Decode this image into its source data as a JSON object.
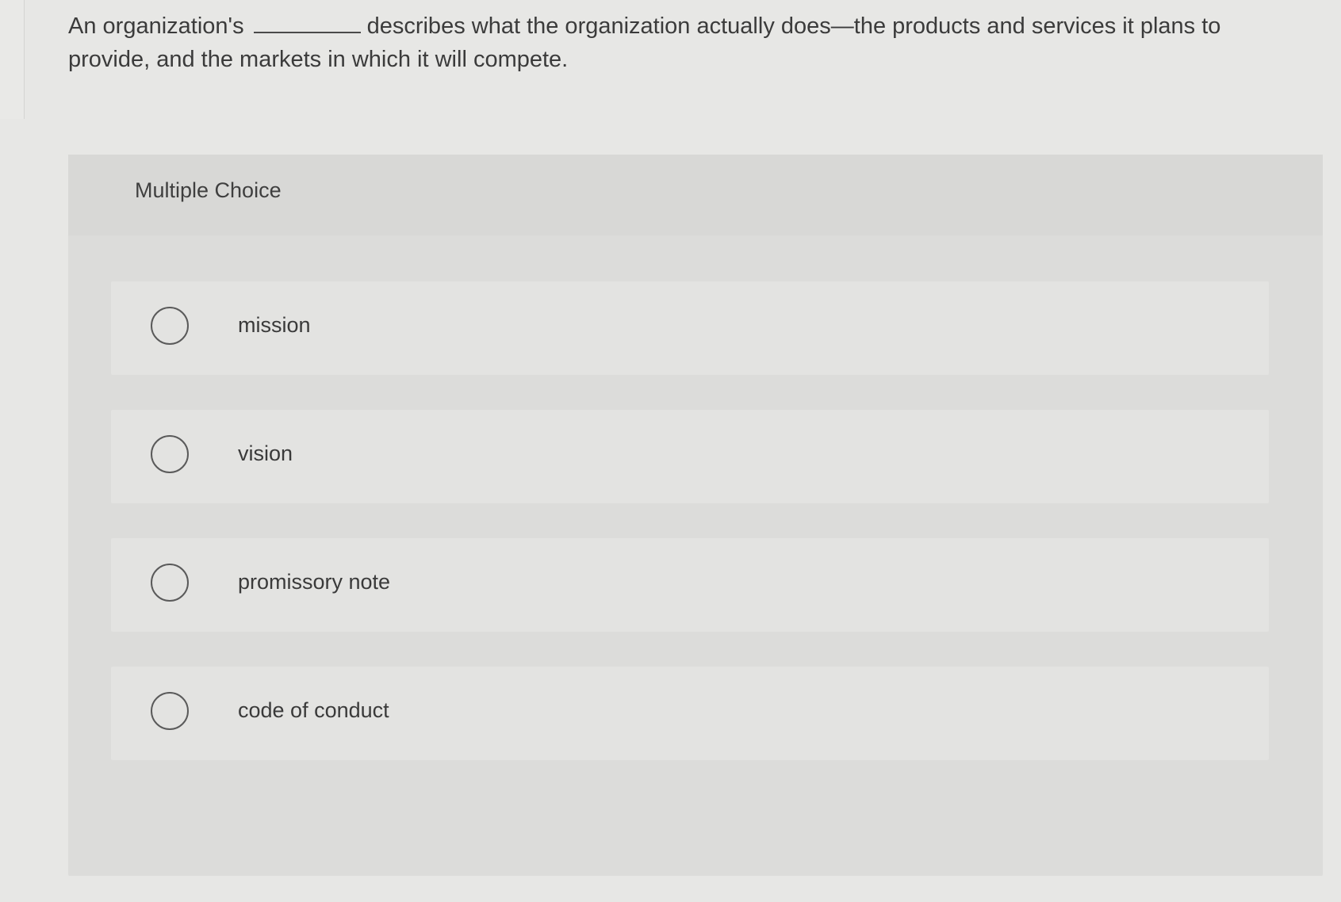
{
  "question": {
    "text_before": "An organization's",
    "text_after": "describes what the organization actually does—the products and services it plans to provide, and the markets in which it will compete."
  },
  "panel": {
    "title": "Multiple Choice",
    "options": [
      {
        "label": "mission"
      },
      {
        "label": "vision"
      },
      {
        "label": "promissory note"
      },
      {
        "label": "code of conduct"
      }
    ]
  },
  "colors": {
    "page_background": "#e7e7e5",
    "panel_background": "#dcdcda",
    "option_background": "#e3e3e1",
    "text": "#3a3a3a"
  },
  "icons": {
    "option_marker": "radio-circle-icon"
  }
}
